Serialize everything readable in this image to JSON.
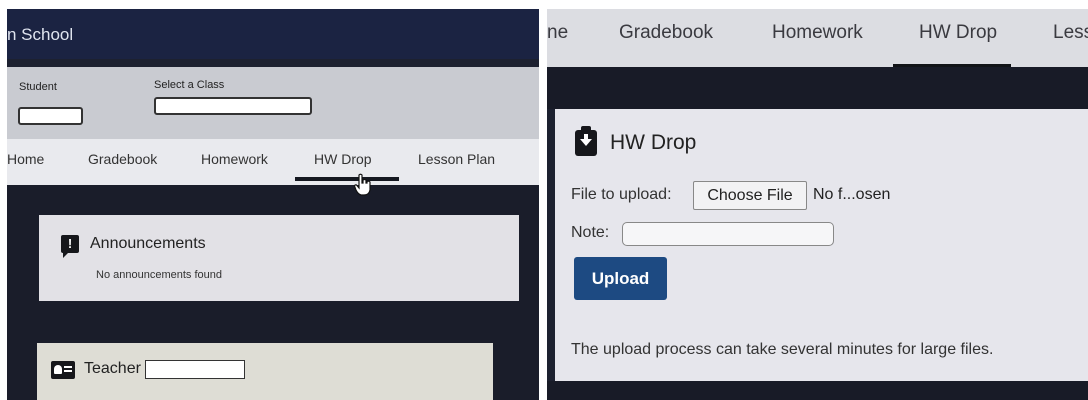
{
  "left": {
    "header": {
      "title": "n School"
    },
    "selectors": {
      "student_label": "Student",
      "class_label": "Select a Class"
    },
    "nav": {
      "tabs": [
        "Home",
        "Gradebook",
        "Homework",
        "HW Drop",
        "Lesson Plan"
      ],
      "active": "HW Drop"
    },
    "announcements": {
      "title": "Announcements",
      "empty_text": "No announcements found"
    },
    "teacher": {
      "title": "Teacher"
    }
  },
  "right": {
    "nav": {
      "tabs": [
        "ne",
        "Gradebook",
        "Homework",
        "HW Drop",
        "Less"
      ],
      "active": "HW Drop"
    },
    "hw_drop": {
      "title": "HW Drop",
      "file_label": "File to upload:",
      "choose_file_label": "Choose File",
      "file_status": "No f...osen",
      "note_label": "Note:",
      "note_value": "",
      "upload_label": "Upload",
      "info_text": "The upload process can take several minutes for large files."
    }
  },
  "colors": {
    "dark_bg": "#1a1d2a",
    "header_bg": "#1b2342",
    "primary_button": "#1d4a82"
  }
}
